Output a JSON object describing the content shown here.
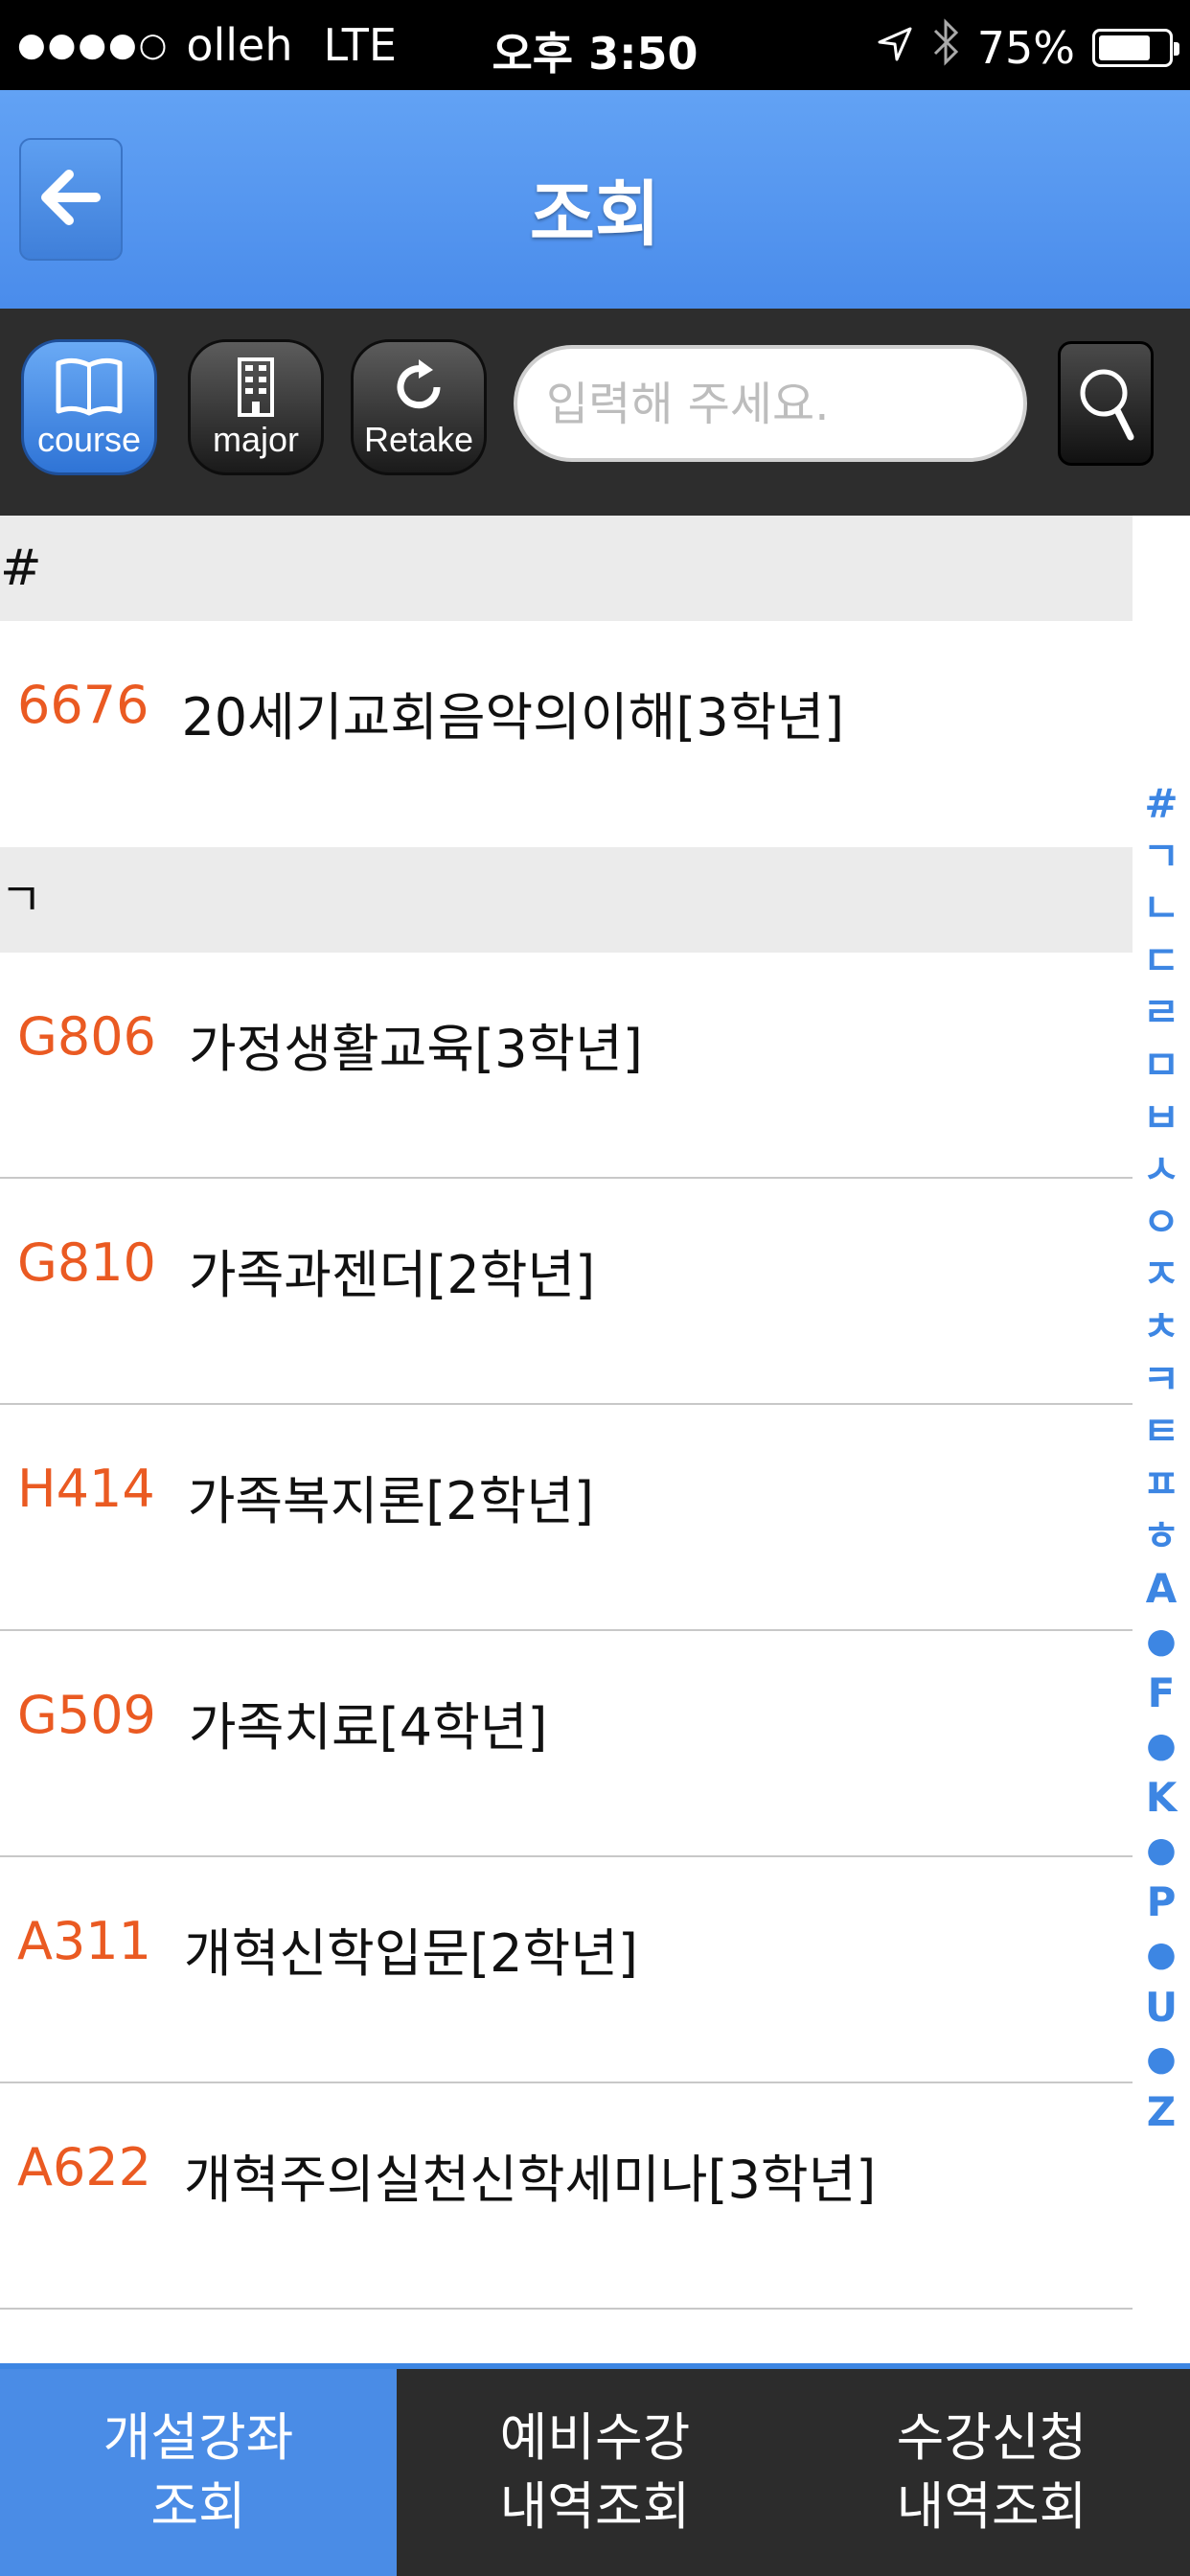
{
  "status_bar": {
    "signal": "●●●●○",
    "carrier": "olleh",
    "network": "LTE",
    "time": "오후 3:50",
    "battery": "75%",
    "battery_level": 0.75
  },
  "nav": {
    "title": "조회"
  },
  "toolbar": {
    "course_label": "course",
    "major_label": "major",
    "retake_label": "Retake",
    "search_placeholder": "입력해 주세요.",
    "search_value": ""
  },
  "sections": [
    {
      "header": "#",
      "items": [
        {
          "code": "6676",
          "title": "20세기교회음악의이해[3학년]"
        }
      ]
    },
    {
      "header": "ㄱ",
      "items": [
        {
          "code": "G806",
          "title": "가정생활교육[3학년]"
        },
        {
          "code": "G810",
          "title": "가족과젠더[2학년]"
        },
        {
          "code": "H414",
          "title": "가족복지론[2학년]"
        },
        {
          "code": "G509",
          "title": "가족치료[4학년]"
        },
        {
          "code": "A311",
          "title": "개혁신학입문[2학년]"
        },
        {
          "code": "A622",
          "title": "개혁주의실천신학세미나[3학년]"
        }
      ]
    }
  ],
  "index_bar": [
    "#",
    "ㄱ",
    "ㄴ",
    "ㄷ",
    "ㄹ",
    "ㅁ",
    "ㅂ",
    "ㅅ",
    "ㅇ",
    "ㅈ",
    "ㅊ",
    "ㅋ",
    "ㅌ",
    "ㅍ",
    "ㅎ",
    "A",
    "●",
    "F",
    "●",
    "K",
    "●",
    "P",
    "●",
    "U",
    "●",
    "Z"
  ],
  "tabs": [
    {
      "line1": "개설강좌",
      "line2": "조회",
      "active": true
    },
    {
      "line1": "예비수강",
      "line2": "내역조회",
      "active": false
    },
    {
      "line1": "수강신청",
      "line2": "내역조회",
      "active": false
    }
  ],
  "colors": {
    "accent": "#4a8ce6",
    "code": "#ea5a22"
  }
}
